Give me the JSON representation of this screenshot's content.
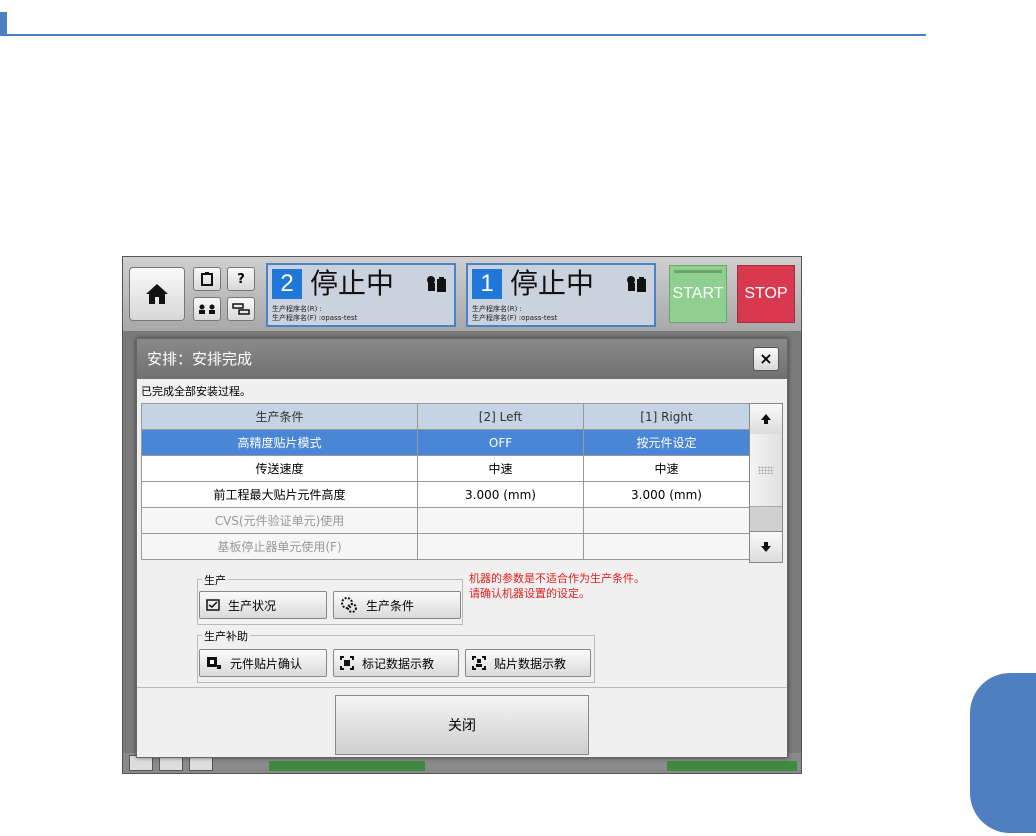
{
  "topbar": {
    "lanes": [
      {
        "number": "2",
        "state": "停止中",
        "prog_r": "生产程序名(R) :",
        "prog_f": "生产程序名(F) :opass-test"
      },
      {
        "number": "1",
        "state": "停止中",
        "prog_r": "生产程序名(R) :",
        "prog_f": "生产程序名(F) :opass-test"
      }
    ],
    "start": "START",
    "stop": "STOP"
  },
  "dialog": {
    "title": "安排：安排完成",
    "close": "×",
    "message": "已完成全部安装过程。",
    "columns": [
      "生产条件",
      "[2] Left",
      "[1] Right"
    ],
    "rows": [
      {
        "name": "高精度贴片模式",
        "left": "OFF",
        "right": "按元件设定",
        "state": "selected"
      },
      {
        "name": "传送速度",
        "left": "中速",
        "right": "中速",
        "state": "normal"
      },
      {
        "name": "前工程最大贴片元件高度",
        "left": "3.000 (mm)",
        "right": "3.000 (mm)",
        "state": "normal"
      },
      {
        "name": "CVS(元件验证单元)使用",
        "left": "",
        "right": "",
        "state": "disabled"
      },
      {
        "name": "基板停止器单元使用(F)",
        "left": "",
        "right": "",
        "state": "disabled"
      }
    ],
    "production_group": {
      "label": "生产",
      "status_btn": "生产状况",
      "condition_btn": "生产条件"
    },
    "assist_group": {
      "label": "生产补助",
      "btn1": "元件贴片确认",
      "btn2": "标记数据示教",
      "btn3": "贴片数据示教"
    },
    "warning": [
      "机器的参数是不适合作为生产条件。",
      "请确认机器设置的设定。"
    ],
    "close_button": "关闭"
  },
  "colors": {
    "accent": "#4a7fc4",
    "selected_row": "#4a86d6",
    "start": "#8fcf8f",
    "stop": "#d9394e",
    "warning": "#e02020"
  }
}
